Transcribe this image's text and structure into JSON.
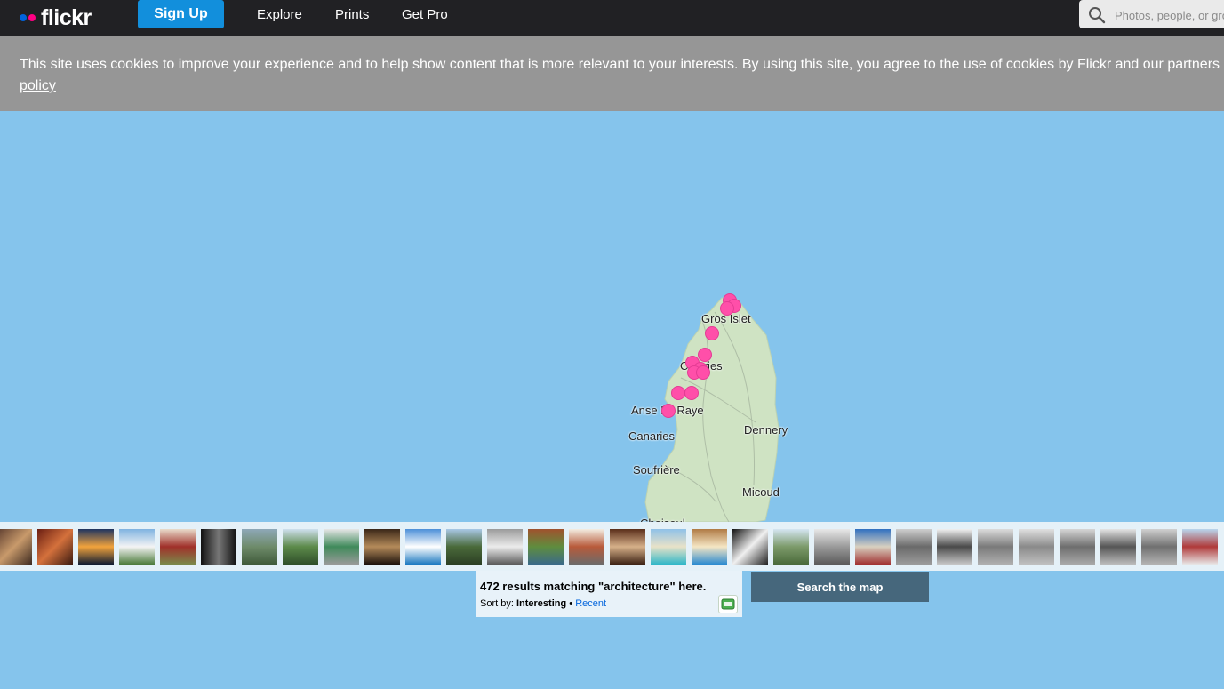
{
  "header": {
    "logo_text": "flickr",
    "logo_colors": [
      "#0063dc",
      "#ff0084"
    ],
    "signup_label": "Sign Up",
    "nav": [
      "Explore",
      "Prints",
      "Get Pro"
    ],
    "search_placeholder": "Photos, people, or groups",
    "search_icon": "search-icon"
  },
  "cookie_banner": {
    "text": "This site uses cookies to improve your experience and to help show content that is more relevant to your interests. By using this site, you agree to the use of cookies by Flickr and our partners",
    "link_text": "policy"
  },
  "map": {
    "places": [
      "Gros Islet",
      "Castries",
      "Anse La Raye",
      "Canaries",
      "Dennery",
      "Soufrière",
      "Micoud",
      "Choiseul"
    ],
    "water_color": "#85c4ec",
    "marker_color": "#ff4fa9"
  },
  "photo_strip": {
    "thumbnail_count": 30
  },
  "results": {
    "count_text": "472 results matching \"architecture\" here.",
    "sort_prefix": "Sort by:",
    "sort_selected": "Interesting",
    "sort_separator": "•",
    "sort_other": "Recent",
    "slideshow_icon": "slideshow-icon"
  },
  "search_map_label": "Search the map"
}
